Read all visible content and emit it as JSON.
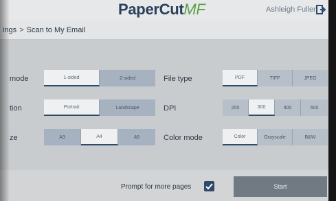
{
  "header": {
    "logo_main": "PaperCut",
    "logo_suffix": "MF",
    "user_name": "Ashleigh Fuller"
  },
  "breadcrumb": {
    "parent": "ings",
    "separator": ">",
    "current": "Scan to My Email"
  },
  "settings": {
    "duplex": {
      "label": "mode",
      "options": [
        "1-sided",
        "2-sided"
      ],
      "selected": "1-sided"
    },
    "orientation": {
      "label": "tion",
      "options": [
        "Portrait",
        "Landscape"
      ],
      "selected": "Portrait"
    },
    "paper_size": {
      "label": "ze",
      "options": [
        "A3",
        "A4",
        "A5"
      ],
      "selected": "A4"
    },
    "file_type": {
      "label": "File type",
      "options": [
        "PDF",
        "TIFF",
        "JPEG"
      ],
      "selected": "PDF"
    },
    "dpi": {
      "label": "DPI",
      "options": [
        "200",
        "300",
        "400",
        "600"
      ],
      "selected": "300"
    },
    "color_mode": {
      "label": "Color mode",
      "options": [
        "Color",
        "Grayscale",
        "B&W"
      ],
      "selected": "Color"
    }
  },
  "footer": {
    "prompt_label": "Prompt for more pages",
    "prompt_checked": true,
    "start_label": "Start"
  },
  "icons": {
    "logout": "logout-icon",
    "check": "checkmark-icon"
  }
}
